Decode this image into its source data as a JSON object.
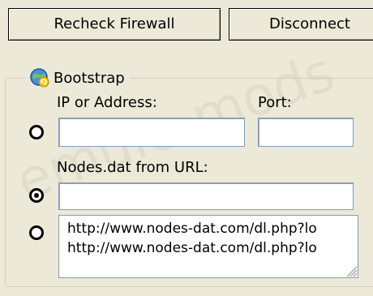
{
  "buttons": {
    "recheck_firewall": "Recheck Firewall",
    "disconnect": "Disconnect"
  },
  "bootstrap": {
    "title": "Bootstrap",
    "ip_label": "IP or Address:",
    "port_label": "Port:",
    "ip_value": "",
    "port_value": "",
    "nodes_label": "Nodes.dat from URL:",
    "nodes_url_value": "",
    "selected_option": "nodes_dat_from_url",
    "url_list": [
      "http://www.nodes-dat.com/dl.php?lo",
      "http://www.nodes-dat.com/dl.php?lo"
    ]
  },
  "watermark": "emule-mods"
}
